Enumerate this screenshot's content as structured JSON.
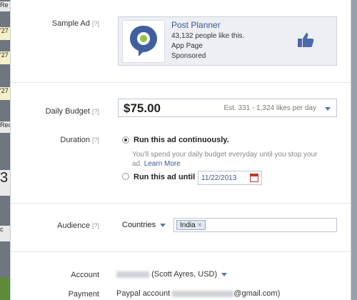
{
  "background": {
    "fragments": [
      "Re",
      "'27",
      "'27",
      "'27",
      "Rec",
      "3",
      "c",
      ""
    ]
  },
  "sample_ad": {
    "label": "Sample Ad",
    "help": "[?]",
    "page_name": "Post Planner",
    "likes_text": "43,132 people like this.",
    "page_type": "App Page",
    "sponsored": "Sponsored"
  },
  "daily_budget": {
    "label": "Daily Budget",
    "help": "[?]",
    "amount": "$75.00",
    "estimate": "Est. 331 - 1,324 likes per day"
  },
  "duration": {
    "label": "Duration",
    "help": "[?]",
    "option_continuous": "Run this ad continuously.",
    "continuous_note": "You'll spend your daily budget everyday until you stop your ad.",
    "learn_more": "Learn More",
    "option_until": "Run this ad until",
    "until_date": "11/22/2013",
    "selected": "continuous"
  },
  "audience": {
    "label": "Audience",
    "help": "[?]",
    "selector": "Countries",
    "tokens": [
      "India"
    ]
  },
  "account": {
    "label": "Account",
    "owner": "(Scott Ayres, USD)"
  },
  "payment": {
    "label": "Payment",
    "prefix": "Paypal account",
    "email_suffix": "@gmail.com)"
  },
  "colors": {
    "link": "#3b5998",
    "ad_background": "#edeff4",
    "pin_blue": "#3f5f9e",
    "pin_green": "#8dc63f"
  },
  "icons": [
    "post-planner-logo",
    "like-thumb-icon",
    "calendar-icon",
    "chevron-down-icon",
    "remove-token-icon"
  ]
}
